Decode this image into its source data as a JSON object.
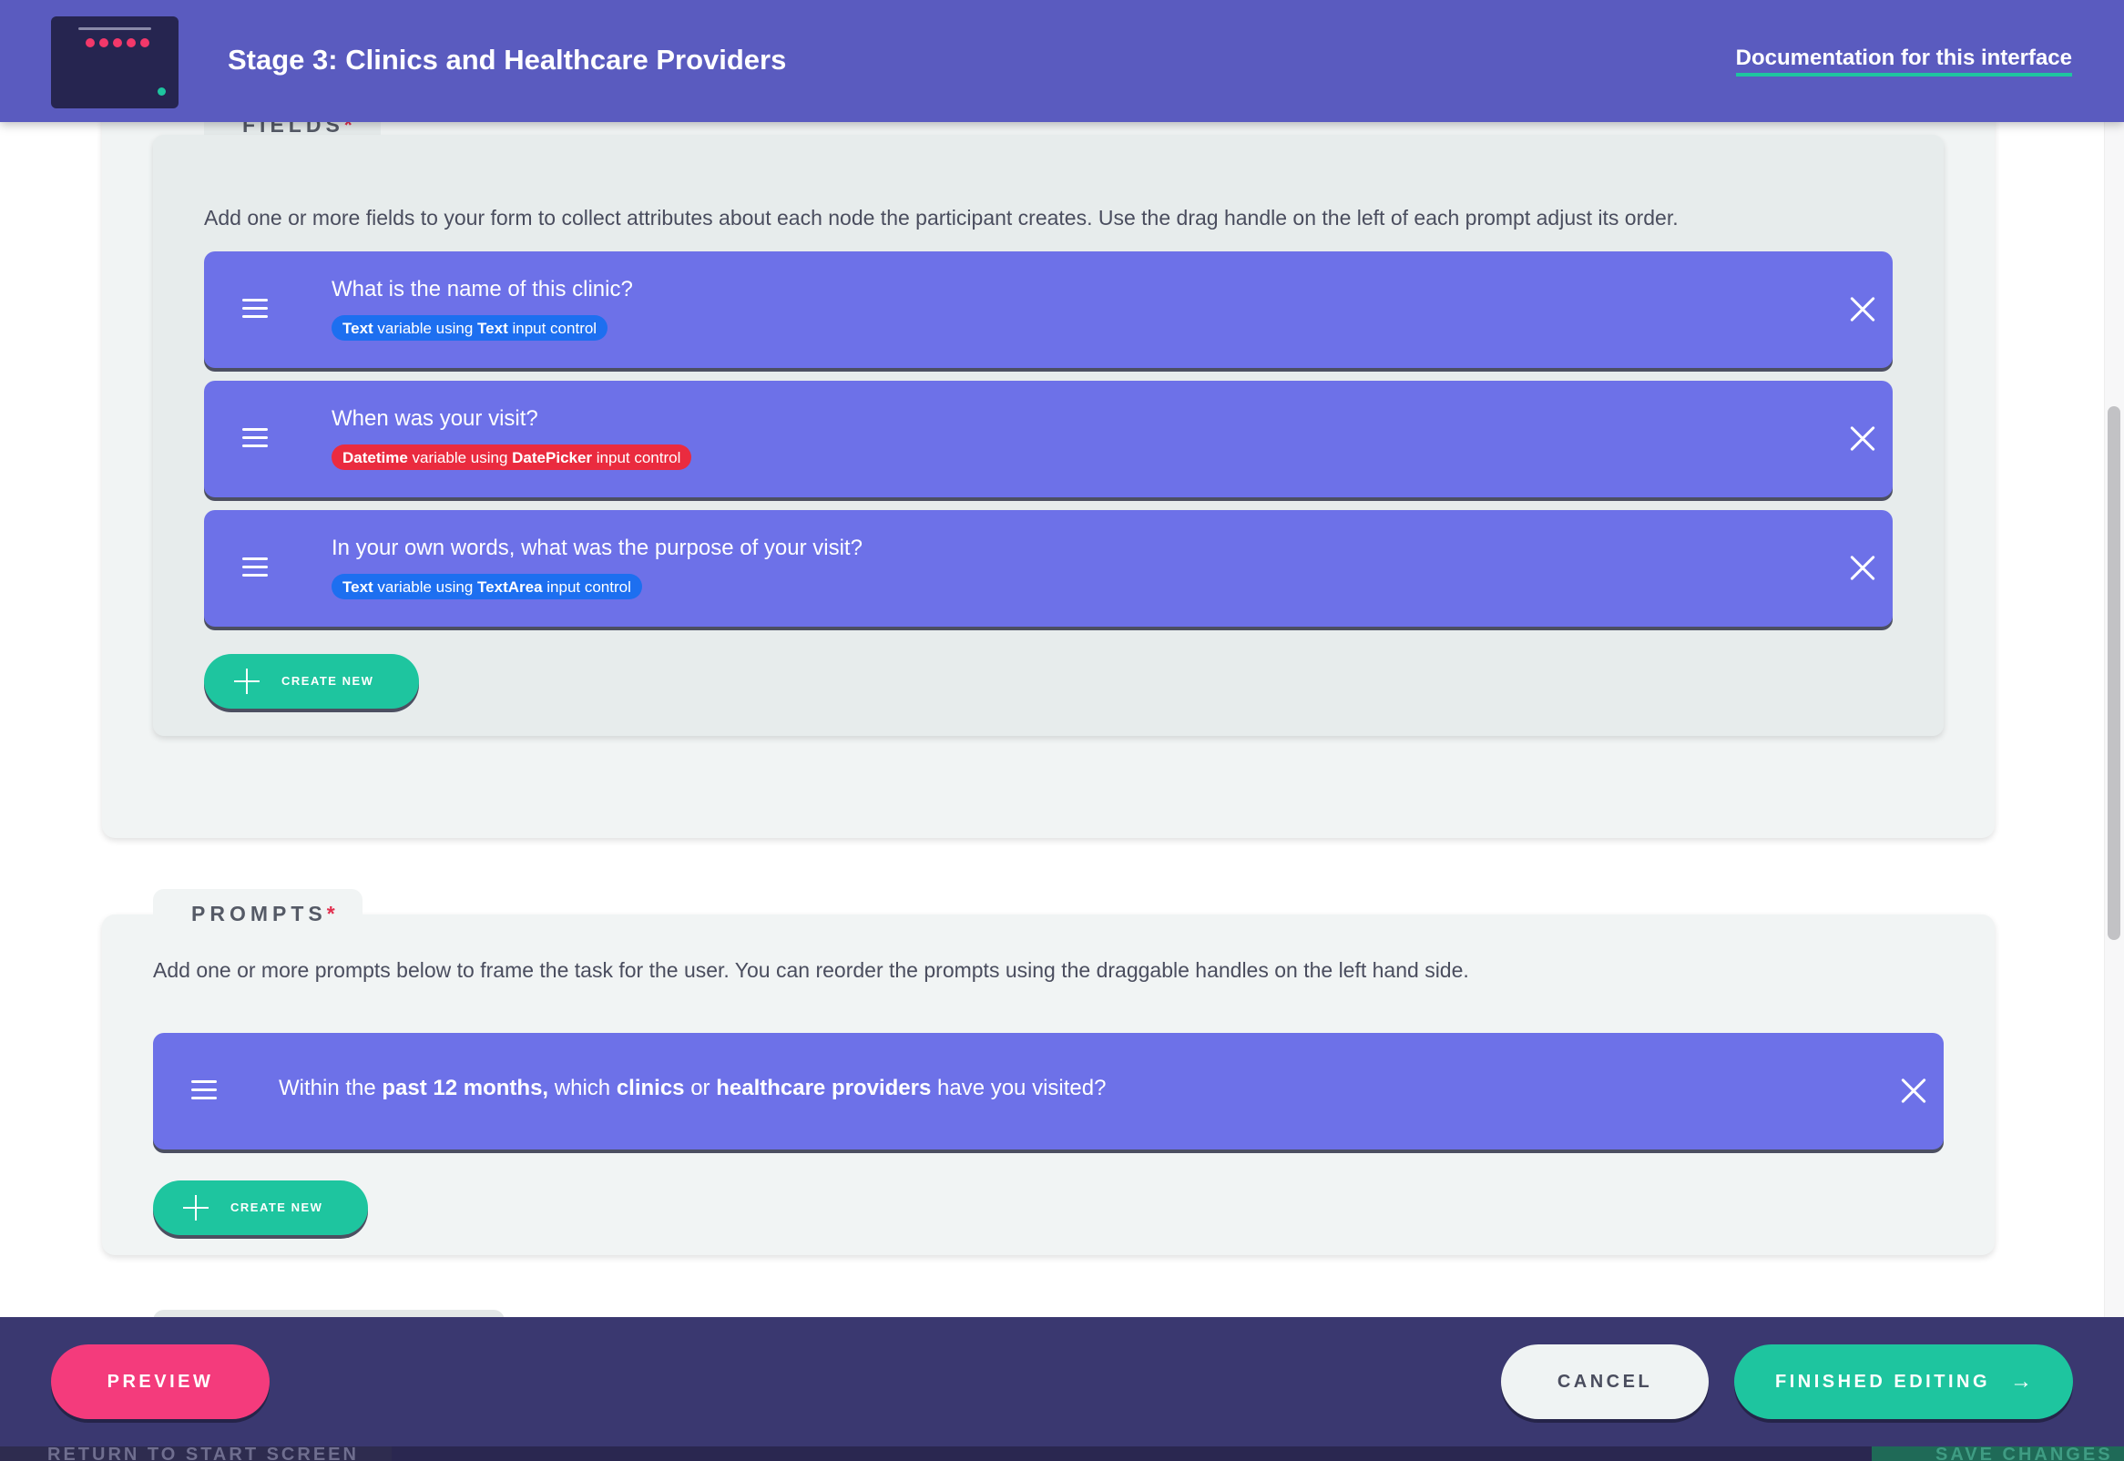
{
  "header": {
    "stage_title": "Stage 3: Clinics and Healthcare Providers",
    "documentation_link": "Documentation for this interface"
  },
  "fields_section": {
    "tab_label": "FIELDS",
    "required_marker": "*",
    "description": "Add one or more fields to your form to collect attributes about each node the participant creates. Use the drag handle on the left of each prompt adjust its order.",
    "items": [
      {
        "question": "What is the name of this clinic?",
        "badge_variable": "Text",
        "badge_middle": " variable using ",
        "badge_control": "Text",
        "badge_suffix": " input control",
        "badge_color": "#1d6ff0"
      },
      {
        "question": "When was your visit?",
        "badge_variable": "Datetime",
        "badge_middle": " variable using ",
        "badge_control": "DatePicker",
        "badge_suffix": " input control",
        "badge_color": "#ea2b3f"
      },
      {
        "question": "In your own words, what was the purpose of your visit?",
        "badge_variable": "Text",
        "badge_middle": " variable using ",
        "badge_control": "TextArea",
        "badge_suffix": " input control",
        "badge_color": "#1d6ff0"
      }
    ],
    "create_new_label": "CREATE NEW"
  },
  "prompts_section": {
    "tab_label": "PROMPTS",
    "required_marker": "*",
    "description": "Add one or more prompts below to frame the task for the user. You can reorder the prompts using the draggable handles on the left hand side.",
    "prompt": {
      "part1": "Within the ",
      "part2": "past 12 months,",
      "part3": " which ",
      "part4": "clinics",
      "part5": " or ",
      "part6": "healthcare providers",
      "part7": " have you visited?"
    },
    "create_new_label": "CREATE NEW"
  },
  "footer": {
    "preview_label": "PREVIEW",
    "cancel_label": "CANCEL",
    "finished_label": "FINISHED EDITING",
    "finished_icon": "arrow-right-icon"
  },
  "underlying_app": {
    "return_label": "RETURN TO START SCREEN",
    "save_label": "SAVE CHANGES"
  },
  "colors": {
    "header": "#5a5bbf",
    "card": "#6d71e8",
    "accent_green": "#1ec59f",
    "accent_pink": "#f43b7c",
    "footer": "#3a3870",
    "required": "#e2304f"
  }
}
